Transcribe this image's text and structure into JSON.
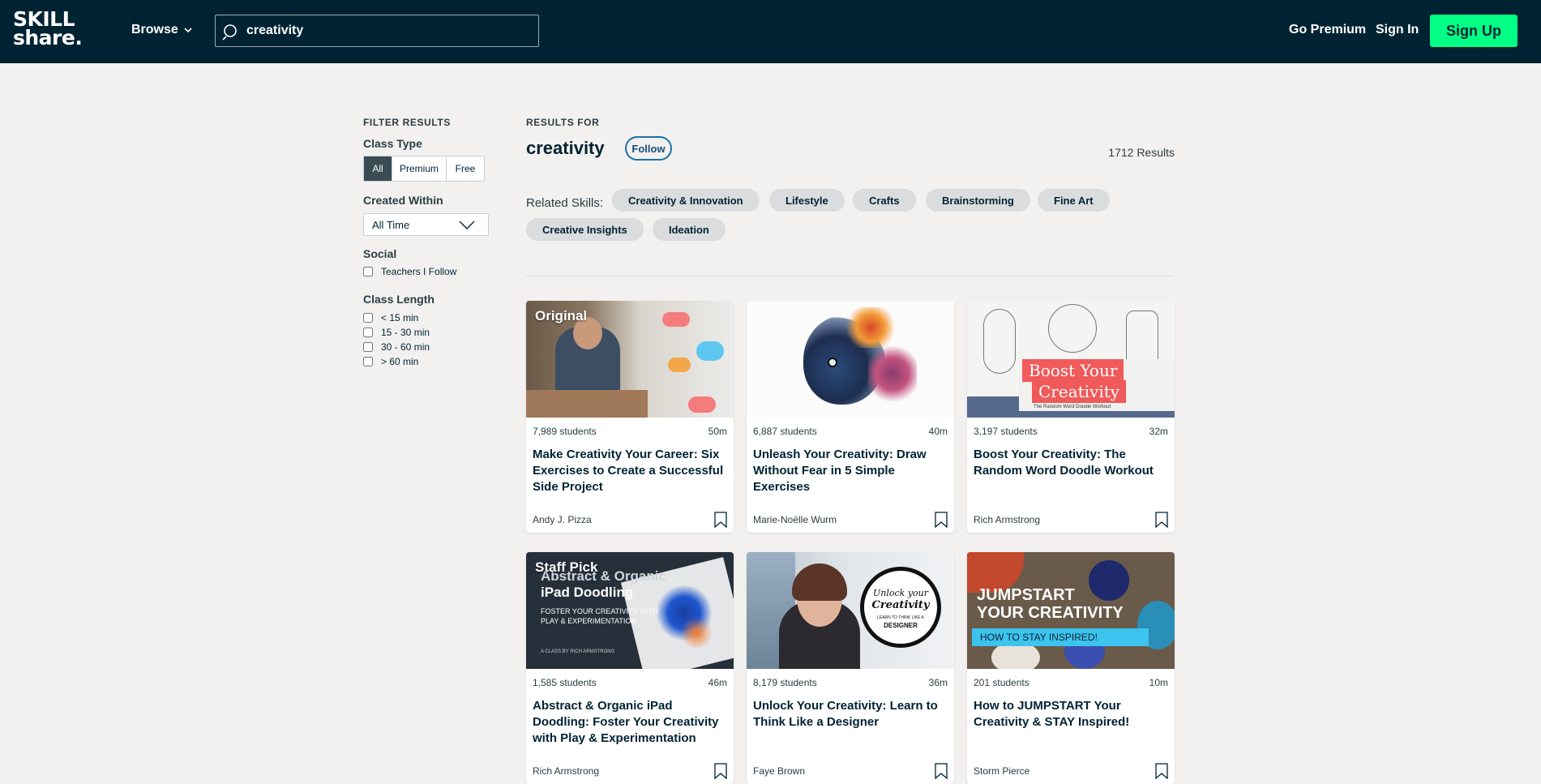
{
  "header": {
    "logo_line1": "SKILL",
    "logo_line2": "share.",
    "browse_label": "Browse",
    "search_value": "creativity",
    "go_premium": "Go Premium",
    "sign_in": "Sign In",
    "sign_up": "Sign Up"
  },
  "filters": {
    "title": "FILTER RESULTS",
    "class_type_label": "Class Type",
    "class_type_options": [
      "All",
      "Premium",
      "Free"
    ],
    "class_type_selected": "All",
    "created_within_label": "Created Within",
    "created_within_value": "All Time",
    "social_label": "Social",
    "social_option": "Teachers I Follow",
    "class_length_label": "Class Length",
    "class_length_options": [
      "< 15 min",
      "15 - 30 min",
      "30 - 60 min",
      "> 60 min"
    ]
  },
  "results": {
    "results_for": "RESULTS FOR",
    "query": "creativity",
    "follow_label": "Follow",
    "count": "1712 Results",
    "related_label": "Related Skills:",
    "related_skills": [
      "Creativity & Innovation",
      "Lifestyle",
      "Crafts",
      "Brainstorming",
      "Fine Art",
      "Creative Insights",
      "Ideation"
    ]
  },
  "cards": [
    {
      "tag": "Original",
      "students": "7,989 students",
      "duration": "50m",
      "title": "Make Creativity Your Career: Six Exercises to Create a Successful Side Project",
      "author": "Andy J. Pizza"
    },
    {
      "tag": "",
      "students": "6,887 students",
      "duration": "40m",
      "title": "Unleash Your Creativity: Draw Without Fear in 5 Simple Exercises",
      "author": "Marie-Noëlle Wurm"
    },
    {
      "tag": "",
      "students": "3,197 students",
      "duration": "32m",
      "title": "Boost Your Creativity: The Random Word Doodle Workout",
      "author": "Rich Armstrong",
      "thumb_text_1": "Boost Your",
      "thumb_text_2": "Creativity",
      "thumb_text_3": "The Random Word Doodle Workout"
    },
    {
      "tag": "Staff Pick",
      "students": "1,585 students",
      "duration": "46m",
      "title": "Abstract & Organic iPad Doodling: Foster Your Creativity with Play & Experimentation",
      "author": "Rich Armstrong",
      "thumb_text_1": "Abstract & Organic",
      "thumb_text_2": "iPad Doodling",
      "thumb_text_3": "FOSTER YOUR CREATIVITY WITH",
      "thumb_text_4": "PLAY & EXPERIMENTATION",
      "thumb_text_5": "A CLASS BY RICH ARMSTRONG"
    },
    {
      "tag": "",
      "students": "8,179 students",
      "duration": "36m",
      "title": "Unlock Your Creativity: Learn to Think Like a Designer",
      "author": "Faye Brown",
      "thumb_text_1": "Unlock your",
      "thumb_text_2": "Creativity",
      "thumb_text_3": "LEARN TO THINK LIKE A",
      "thumb_text_4": "DESIGNER"
    },
    {
      "tag": "",
      "students": "201 students",
      "duration": "10m",
      "title": "How to JUMPSTART Your Creativity & STAY Inspired!",
      "author": "Storm Pierce",
      "thumb_text_1": "JUMPSTART",
      "thumb_text_2": "YOUR CREATIVITY",
      "thumb_text_3": "HOW TO STAY INSPIRED!"
    }
  ],
  "colors": {
    "header_bg": "#002333",
    "signup_bg": "#00ff84",
    "page_bg": "#f2f1ef",
    "follow_border": "#1c6fa8"
  }
}
